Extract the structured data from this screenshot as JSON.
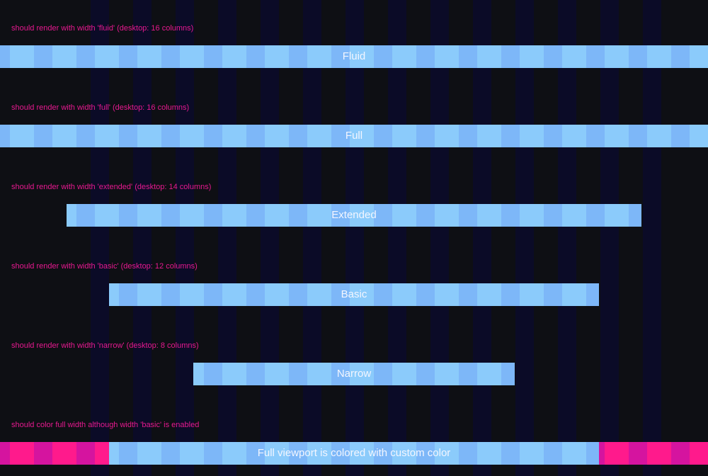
{
  "colors": {
    "bg_col_a": "#0e0f14",
    "bg_col_b": "#0b0b27",
    "bar_light": "#8bcbfb",
    "bar_dark": "#7db7f8",
    "label": "#e6198f",
    "text": "#f3f6ff",
    "accent_a": "#ff1a8c",
    "accent_b": "#d5149f"
  },
  "sections": [
    {
      "label": "should render with width 'fluid' (desktop: 16 columns)",
      "text": "Fluid"
    },
    {
      "label": "should render with width 'full' (desktop: 16 columns)",
      "text": "Full"
    },
    {
      "label": "should render with width 'extended' (desktop: 14 columns)",
      "text": "Extended"
    },
    {
      "label": "should render with width 'basic' (desktop: 12 columns)",
      "text": "Basic"
    },
    {
      "label": "should render with width 'narrow' (desktop: 8 columns)",
      "text": "Narrow"
    },
    {
      "label": "should color full width although width 'basic' is enabled",
      "text": "Full viewport is colored with custom color"
    }
  ]
}
